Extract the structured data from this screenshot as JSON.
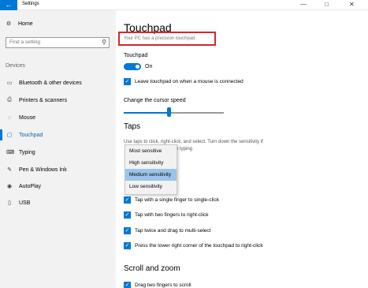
{
  "window": {
    "title": "Settings",
    "back_icon": "←",
    "minimize": "—",
    "maximize": "□",
    "close": "✕"
  },
  "sidebar": {
    "home": {
      "label": "Home",
      "icon": "⚙"
    },
    "search_placeholder": "Find a setting",
    "search_icon": "⚲",
    "section": "Devices",
    "items": [
      {
        "label": "Bluetooth & other devices",
        "icon": "▭"
      },
      {
        "label": "Printers & scanners",
        "icon": "⎙"
      },
      {
        "label": "Mouse",
        "icon": "◌"
      },
      {
        "label": "Touchpad",
        "icon": "▢"
      },
      {
        "label": "Typing",
        "icon": "⌨"
      },
      {
        "label": "Pen & Windows Ink",
        "icon": "✎"
      },
      {
        "label": "AutoPlay",
        "icon": "◉"
      },
      {
        "label": "USB",
        "icon": "▯"
      }
    ],
    "active_index": 3
  },
  "main": {
    "title": "Touchpad",
    "precision_text": "Your PC has a precision touchpad.",
    "touchpad_label": "Touchpad",
    "touchpad_state": "On",
    "leave_on_label": "Leave touchpad on when a mouse is connected",
    "cursor_speed_label": "Change the cursor speed",
    "cursor_speed_level": 0.45,
    "taps_title": "Taps",
    "taps_desc_line1": "Use taps to click, right-click, and select. Turn down the sensitivity if",
    "taps_desc_line2": "re typing",
    "sensitivity_options": [
      "Most sensitive",
      "High sensitivity",
      "Medium sensitivity",
      "Low sensitivity"
    ],
    "sensitivity_selected": "Medium sensitivity",
    "tap_options": [
      "Tap with a single finger to single-click",
      "Tap with two fingers to right-click",
      "Tap twice and drag to multi-select",
      "Press the lower right corner of the touchpad to right-click"
    ],
    "scroll_title": "Scroll and zoom",
    "scroll_option": "Drag two fingers to scroll"
  },
  "colors": {
    "accent": "#0078d7",
    "highlight": "#d9262a",
    "selected_item": "#99c5ea"
  }
}
